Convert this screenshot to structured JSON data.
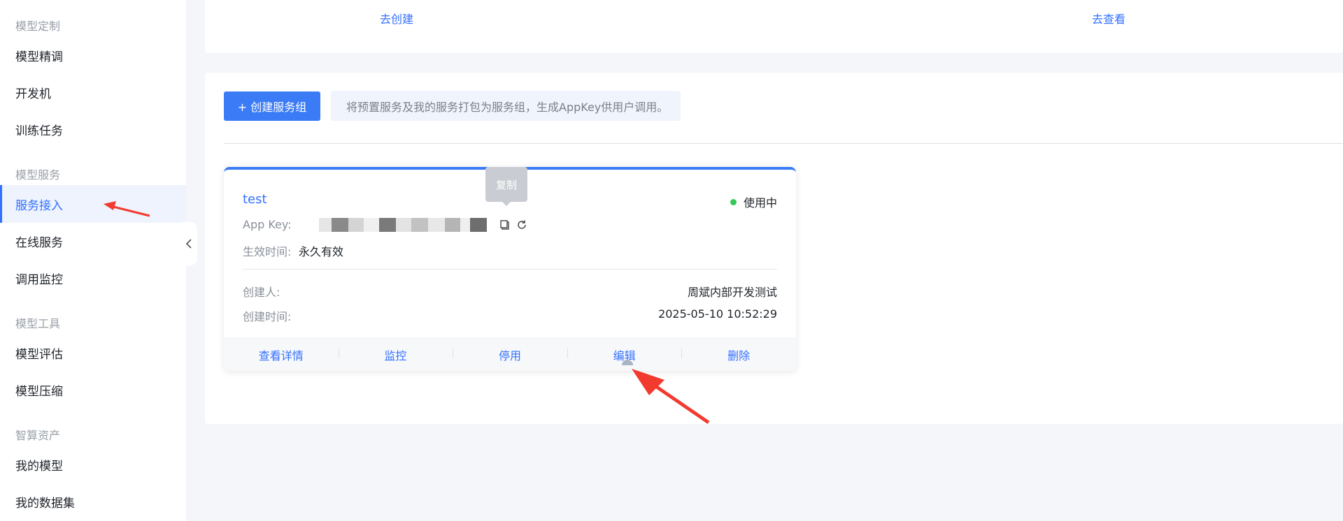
{
  "sidebar": {
    "groups": [
      {
        "title": "模型定制",
        "items": [
          "模型精调",
          "开发机",
          "训练任务"
        ]
      },
      {
        "title": "模型服务",
        "items": [
          "服务接入",
          "在线服务",
          "调用监控"
        ]
      },
      {
        "title": "模型工具",
        "items": [
          "模型评估",
          "模型压缩"
        ]
      },
      {
        "title": "智算资产",
        "items": [
          "我的模型",
          "我的数据集"
        ]
      }
    ],
    "active_item": "服务接入",
    "collapse_icon": "chevron-left-icon"
  },
  "top_card": {
    "link_create": "去创建",
    "link_view": "去查看"
  },
  "toolbar": {
    "create_button": "+ 创建服务组",
    "hint": "将预置服务及我的服务打包为服务组，生成AppKey供用户调用。"
  },
  "service_card": {
    "name": "test",
    "status": "使用中",
    "status_color": "#34c759",
    "app_key_label": "App Key:",
    "tooltip": "复制",
    "valid_label": "生效时间:",
    "valid_value": "永久有效",
    "creator_label": "创建人:",
    "creator_value": "周斌内部开发测试",
    "created_label": "创建时间:",
    "created_value": "2025-05-10 10:52:29",
    "actions": [
      "查看详情",
      "监控",
      "停用",
      "编辑",
      "删除"
    ]
  },
  "colors": {
    "accent": "#3370ff",
    "annotation_arrow": "#f23a2e"
  }
}
